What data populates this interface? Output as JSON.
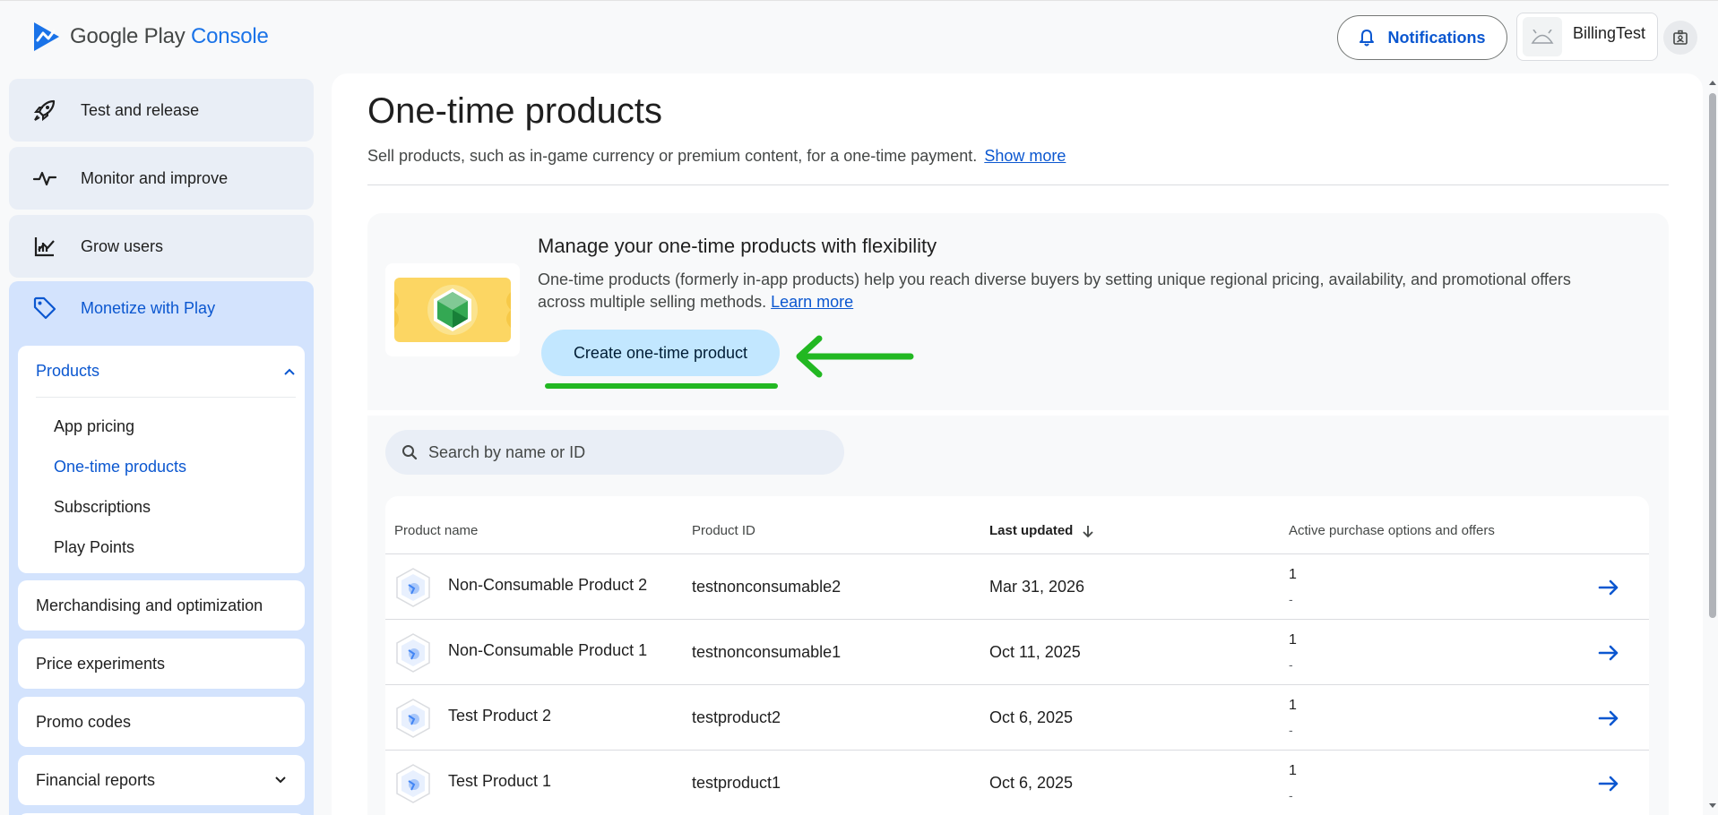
{
  "app": {
    "logo_google": "Google Play",
    "logo_console": "Console",
    "notifications_label": "Notifications",
    "account_name": "BillingTest"
  },
  "sidebar": {
    "test_release": "Test and release",
    "monitor": "Monitor and improve",
    "grow": "Grow users",
    "monetize": "Monetize with Play",
    "products": "Products",
    "sub_items": [
      "App pricing",
      "One-time products",
      "Subscriptions",
      "Play Points"
    ],
    "merch": "Merchandising and optimization",
    "price_exp": "Price experiments",
    "promo": "Promo codes",
    "financial": "Financial reports"
  },
  "page": {
    "title": "One-time products",
    "subtitle": "Sell products, such as in-game currency or premium content, for a one-time payment.",
    "show_more": "Show more"
  },
  "banner": {
    "title": "Manage your one-time products with flexibility",
    "text": "One-time products (formerly in-app products) help you reach diverse buyers by setting unique regional pricing, availability, and promotional offers across multiple selling methods.",
    "learn_more": "Learn more",
    "create_button": "Create one-time product"
  },
  "search": {
    "placeholder": "Search by name or ID"
  },
  "table": {
    "headers": {
      "name": "Product name",
      "id": "Product ID",
      "updated": "Last updated",
      "active": "Active purchase options and offers"
    },
    "rows": [
      {
        "name": "Non-Consumable Product 2",
        "id": "testnonconsumable2",
        "updated": "Mar 31, 2026",
        "count": "1",
        "offers": "-"
      },
      {
        "name": "Non-Consumable Product 1",
        "id": "testnonconsumable1",
        "updated": "Oct 11, 2025",
        "count": "1",
        "offers": "-"
      },
      {
        "name": "Test Product 2",
        "id": "testproduct2",
        "updated": "Oct 6, 2025",
        "count": "1",
        "offers": "-"
      },
      {
        "name": "Test Product 1",
        "id": "testproduct1",
        "updated": "Oct 6, 2025",
        "count": "1",
        "offers": "-"
      }
    ]
  },
  "colors": {
    "accent": "#0b57d0",
    "annotation_green": "#22b822",
    "create_button_bg": "#c2e7ff"
  },
  "icons": {
    "rocket": "rocket-icon",
    "monitor": "vitals-icon",
    "grow": "growth-icon",
    "monetize": "tag-icon",
    "bell": "bell-icon",
    "search": "search-icon",
    "arrow": "arrow-right-icon"
  }
}
